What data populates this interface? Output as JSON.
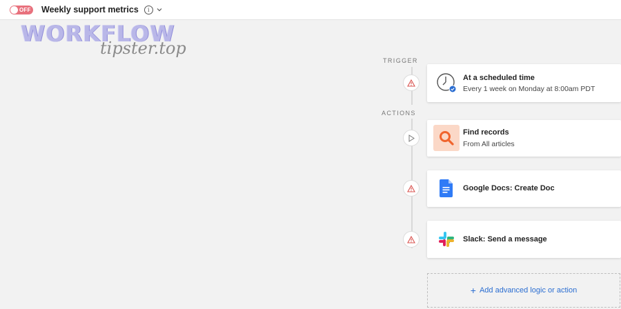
{
  "header": {
    "toggle_label": "OFF",
    "title": "Weekly support metrics",
    "info_icon": "info-icon",
    "chevron_icon": "chevron-down-icon"
  },
  "watermark": {
    "big": "WORKFLOW",
    "small": "tipster.top"
  },
  "flow": {
    "trigger_label": "TRIGGER",
    "actions_label": "ACTIONS",
    "trigger": {
      "title": "At a scheduled time",
      "subtitle": "Every 1 week on Monday at 8:00am PDT",
      "icon": "clock-icon",
      "status_icon": "warning-icon"
    },
    "steps": [
      {
        "title": "Find records",
        "subtitle": "From All articles",
        "icon": "search-icon",
        "status_icon": "play-icon"
      },
      {
        "title": "Google Docs: Create Doc",
        "subtitle": "",
        "icon": "google-docs-icon",
        "status_icon": "warning-icon"
      },
      {
        "title": "Slack: Send a message",
        "subtitle": "",
        "icon": "slack-icon",
        "status_icon": "warning-icon"
      }
    ],
    "add_label": "Add advanced logic or action"
  },
  "colors": {
    "toggle_off": "#e8717d",
    "warning": "#d9534f",
    "accent_blue": "#2a6dd1",
    "search_bg": "#fbd8c7",
    "search_icon": "#f0642d"
  }
}
